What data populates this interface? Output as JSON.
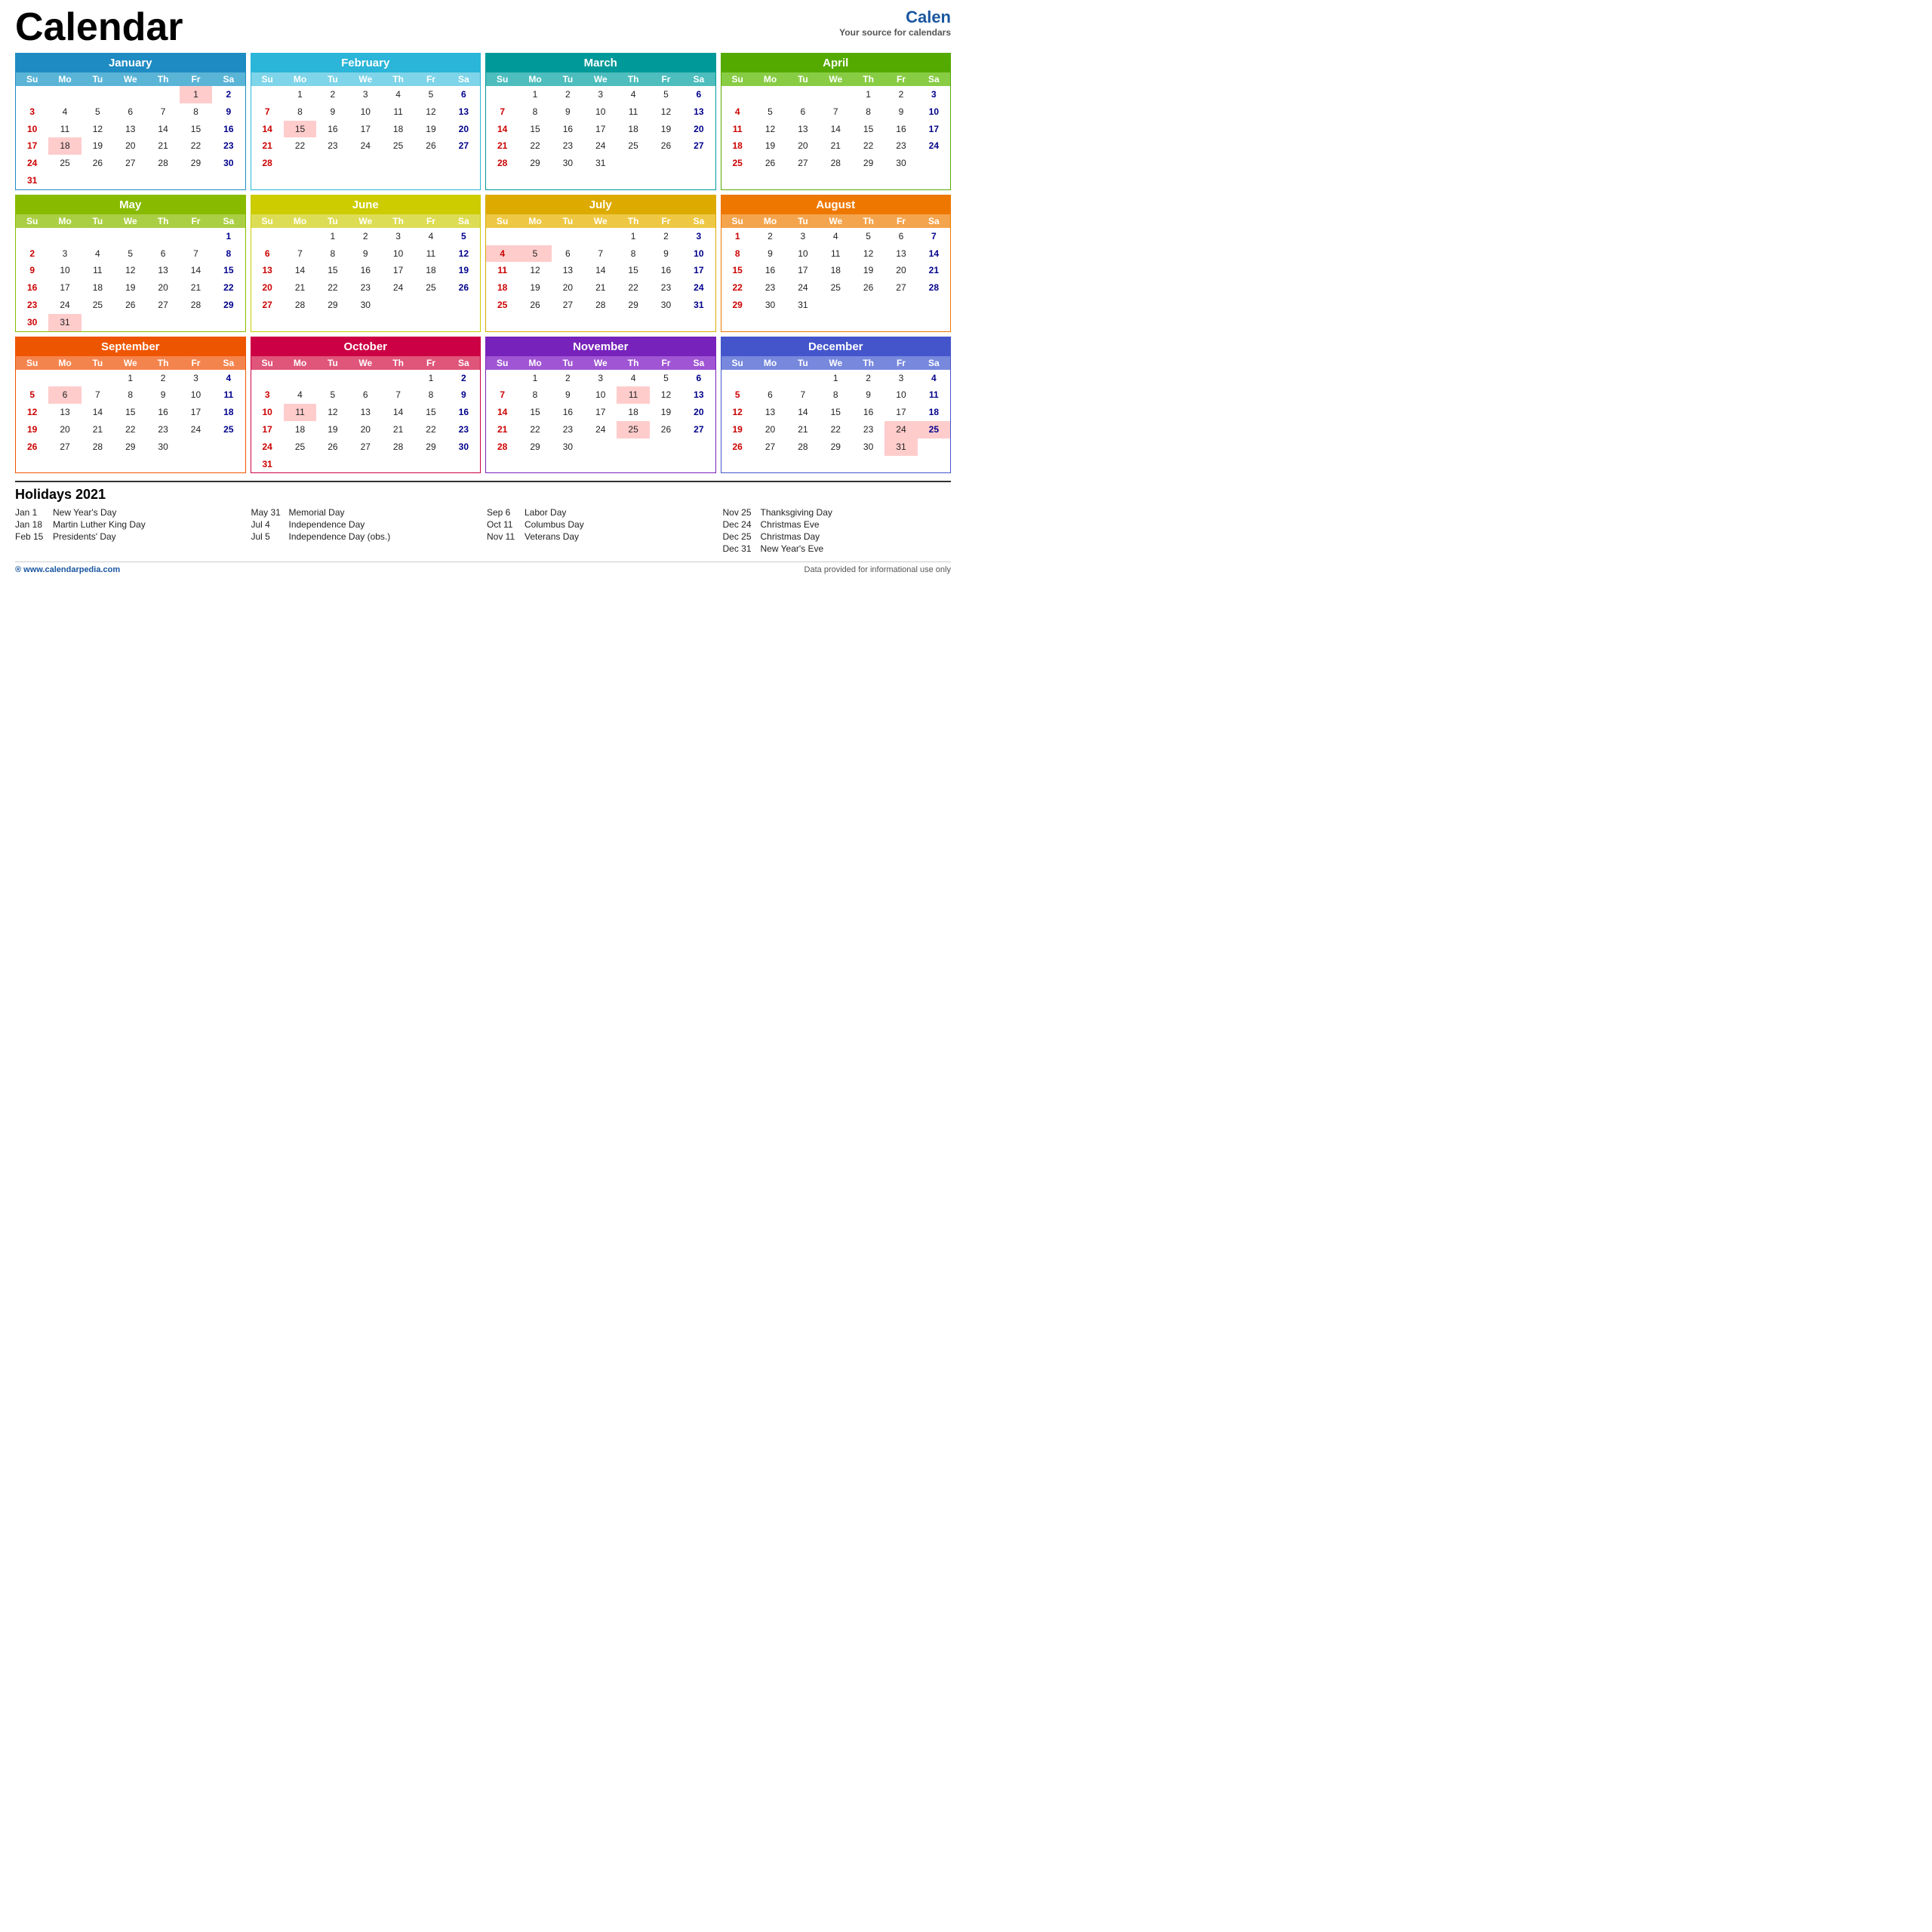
{
  "header": {
    "title": "Calendar",
    "year": "2021",
    "logo": "Calen",
    "logo_full": "Calenderpedia",
    "tagline": "Your source for calendars"
  },
  "months": [
    {
      "name": "January",
      "class": "jan",
      "headerClass": "jan-header",
      "dowClass": "jan-dow",
      "startDay": 5,
      "days": 31,
      "dow": [
        "Su",
        "Mo",
        "Tu",
        "We",
        "Th",
        "Fr",
        "Sa"
      ],
      "holidays": [
        1,
        18
      ]
    },
    {
      "name": "February",
      "class": "feb",
      "headerClass": "feb-header",
      "dowClass": "feb-dow",
      "startDay": 1,
      "days": 28,
      "dow": [
        "Su",
        "Mo",
        "Tu",
        "We",
        "Th",
        "Fr",
        "Sa"
      ],
      "holidays": [
        15
      ]
    },
    {
      "name": "March",
      "class": "mar",
      "headerClass": "mar-header",
      "dowClass": "mar-dow",
      "startDay": 1,
      "days": 31,
      "dow": [
        "Su",
        "Mo",
        "Tu",
        "We",
        "Th",
        "Fr",
        "Sa"
      ],
      "holidays": []
    },
    {
      "name": "April",
      "class": "apr",
      "headerClass": "apr-header",
      "dowClass": "apr-dow",
      "startDay": 4,
      "days": 30,
      "dow": [
        "Su",
        "Mo",
        "Tu",
        "We",
        "Th",
        "Fr",
        "Sa"
      ],
      "holidays": []
    },
    {
      "name": "May",
      "class": "may",
      "headerClass": "may-header",
      "dowClass": "may-dow",
      "startDay": 6,
      "days": 31,
      "dow": [
        "Su",
        "Mo",
        "Tu",
        "We",
        "Th",
        "Fr",
        "Sa"
      ],
      "holidays": [
        31
      ]
    },
    {
      "name": "June",
      "class": "jun",
      "headerClass": "jun-header",
      "dowClass": "jun-dow",
      "startDay": 2,
      "days": 30,
      "dow": [
        "Su",
        "Mo",
        "Tu",
        "We",
        "Th",
        "Fr",
        "Sa"
      ],
      "holidays": []
    },
    {
      "name": "July",
      "class": "jul",
      "headerClass": "jul-header",
      "dowClass": "jul-dow",
      "startDay": 4,
      "days": 31,
      "dow": [
        "Su",
        "Mo",
        "Tu",
        "We",
        "Th",
        "Fr",
        "Sa"
      ],
      "holidays": [
        4,
        5
      ]
    },
    {
      "name": "August",
      "class": "aug",
      "headerClass": "aug-header",
      "dowClass": "aug-dow",
      "startDay": 0,
      "days": 31,
      "dow": [
        "Su",
        "Mo",
        "Tu",
        "We",
        "Th",
        "Fr",
        "Sa"
      ],
      "holidays": []
    },
    {
      "name": "September",
      "class": "sep",
      "headerClass": "sep-header",
      "dowClass": "sep-dow",
      "startDay": 3,
      "days": 30,
      "dow": [
        "Su",
        "Mo",
        "Tu",
        "We",
        "Th",
        "Fr",
        "Sa"
      ],
      "holidays": [
        6
      ]
    },
    {
      "name": "October",
      "class": "oct",
      "headerClass": "oct-header",
      "dowClass": "oct-dow",
      "startDay": 5,
      "days": 31,
      "dow": [
        "Su",
        "Mo",
        "Tu",
        "We",
        "Th",
        "Fr",
        "Sa"
      ],
      "holidays": [
        11
      ]
    },
    {
      "name": "November",
      "class": "nov",
      "headerClass": "nov-header",
      "dowClass": "nov-dow",
      "startDay": 1,
      "days": 30,
      "dow": [
        "Su",
        "Mo",
        "Tu",
        "We",
        "Th",
        "Fr",
        "Sa"
      ],
      "holidays": [
        11,
        25
      ]
    },
    {
      "name": "December",
      "class": "dec",
      "headerClass": "dec-header",
      "dowClass": "dec-dow",
      "startDay": 3,
      "days": 31,
      "dow": [
        "Su",
        "Mo",
        "Tu",
        "We",
        "Th",
        "Fr",
        "Sa"
      ],
      "holidays": [
        24,
        25,
        31
      ]
    }
  ],
  "holidays_section": {
    "title": "Holidays 2021",
    "columns": [
      [
        {
          "date": "Jan 1",
          "name": "New Year's Day"
        },
        {
          "date": "Jan 18",
          "name": "Martin Luther King Day"
        },
        {
          "date": "Feb 15",
          "name": "Presidents' Day"
        }
      ],
      [
        {
          "date": "May 31",
          "name": "Memorial Day"
        },
        {
          "date": "Jul 4",
          "name": "Independence Day"
        },
        {
          "date": "Jul 5",
          "name": "Independence Day (obs.)"
        }
      ],
      [
        {
          "date": "Sep 6",
          "name": "Labor Day"
        },
        {
          "date": "Oct 11",
          "name": "Columbus Day"
        },
        {
          "date": "Nov 11",
          "name": "Veterans Day"
        }
      ],
      [
        {
          "date": "Nov 25",
          "name": "Thanksgiving Day"
        },
        {
          "date": "Dec 24",
          "name": "Christmas Eve"
        },
        {
          "date": "Dec 25",
          "name": "Christmas Day"
        },
        {
          "date": "Dec 31",
          "name": "New Year's Eve"
        }
      ]
    ]
  },
  "footer": {
    "logo": "®  www.calendarpedia.com",
    "rights": "Data provided for informational use only"
  }
}
